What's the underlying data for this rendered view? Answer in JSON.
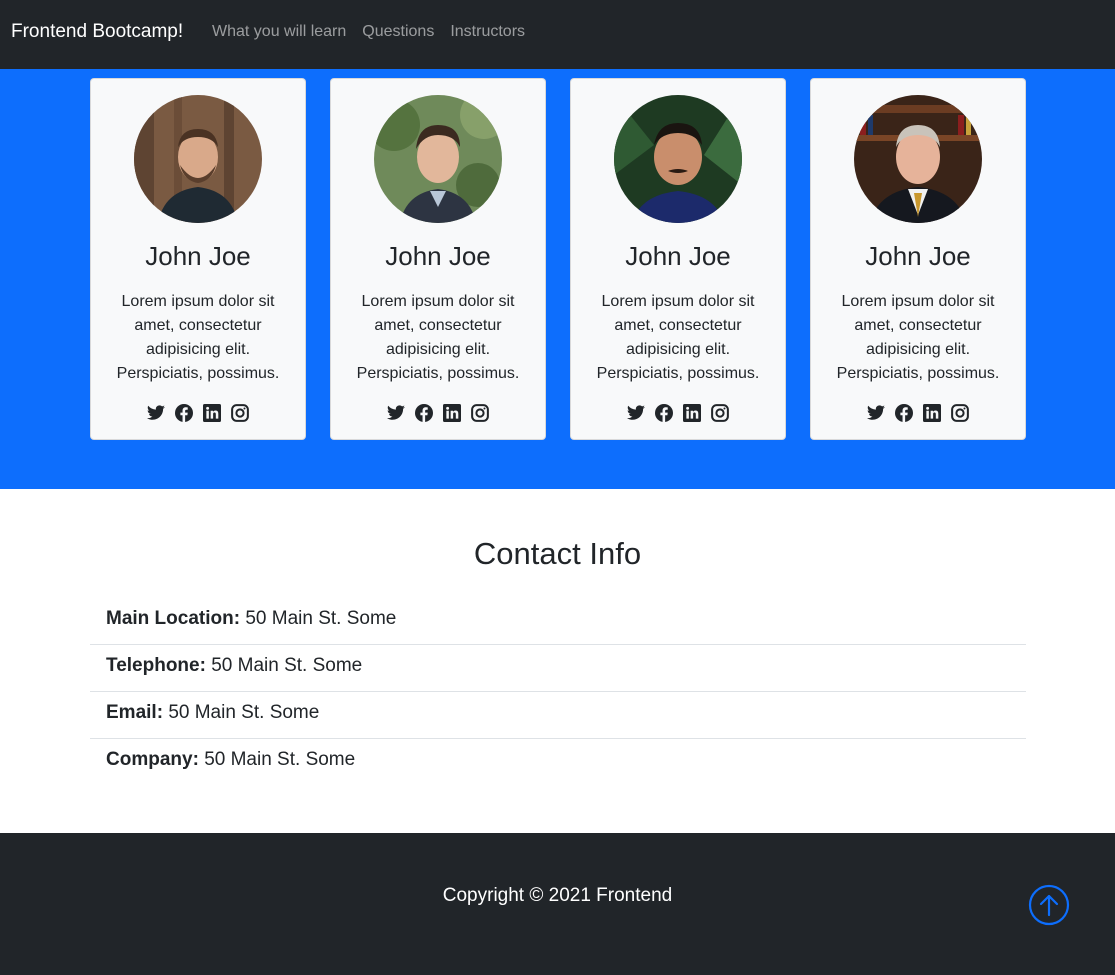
{
  "navbar": {
    "brand": "Frontend Bootcamp!",
    "links": [
      "What you will learn",
      "Questions",
      "Instructors"
    ]
  },
  "instructors": [
    {
      "name": "John Joe",
      "bio": "Lorem ipsum dolor sit amet, consectetur adipisicing elit. Perspiciatis, possimus.",
      "photo": "man-with-beard-photo"
    },
    {
      "name": "John Joe",
      "bio": "Lorem ipsum dolor sit amet, consectetur adipisicing elit. Perspiciatis, possimus.",
      "photo": "young-man-outdoors-photo"
    },
    {
      "name": "John Joe",
      "bio": "Lorem ipsum dolor sit amet, consectetur adipisicing elit. Perspiciatis, possimus.",
      "photo": "man-with-mustache-photo"
    },
    {
      "name": "John Joe",
      "bio": "Lorem ipsum dolor sit amet, consectetur adipisicing elit. Perspiciatis, possimus.",
      "photo": "man-in-suit-photo"
    }
  ],
  "social_icons": [
    "twitter-icon",
    "facebook-icon",
    "linkedin-icon",
    "instagram-icon"
  ],
  "contact": {
    "title": "Contact Info",
    "items": [
      {
        "label": "Main Location:",
        "value": "50 Main St. Some"
      },
      {
        "label": "Telephone:",
        "value": "50 Main St. Some"
      },
      {
        "label": "Email:",
        "value": "50 Main St. Some"
      },
      {
        "label": "Company:",
        "value": "50 Main St. Some"
      }
    ]
  },
  "footer": {
    "copyright": "Copyright © 2021 Frontend",
    "to_top_icon": "arrow-up-circle-icon"
  },
  "colors": {
    "navbar_bg": "#212529",
    "primary": "#0d6efd",
    "card_bg": "#f8f9fa",
    "footer_bg": "#212529"
  }
}
